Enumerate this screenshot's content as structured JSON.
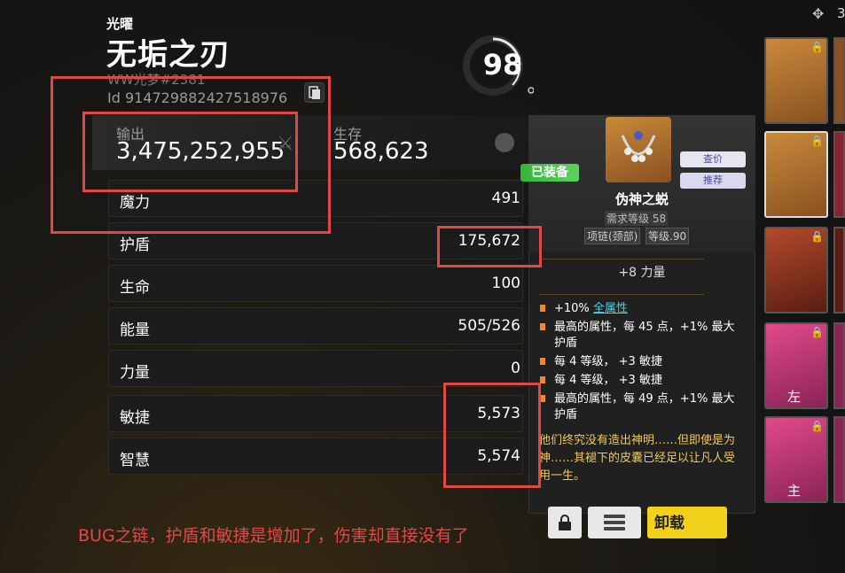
{
  "header": {
    "subtitle": "光曜",
    "title": "无垢之刃",
    "player_tag": "WW光梦#2381",
    "player_id": "Id 914729882427518976",
    "level": "98"
  },
  "top_right": {
    "count": "3"
  },
  "summary": {
    "output_label": "输出",
    "output_value": "3,475,252,955",
    "survival_label": "生存",
    "survival_value": "568,623"
  },
  "stats": [
    {
      "name": "魔力",
      "value": "491"
    },
    {
      "name": "护盾",
      "value": "175,672"
    },
    {
      "name": "生命",
      "value": "100"
    },
    {
      "name": "能量",
      "value": "505/526"
    },
    {
      "name": "力量",
      "value": "0"
    },
    {
      "name": "敏捷",
      "value": "5,573"
    },
    {
      "name": "智慧",
      "value": "5,574"
    }
  ],
  "item": {
    "equipped_badge": "已装备",
    "price_button": "查价",
    "recommend_button": "推荐",
    "name": "伪神之蜕",
    "required_level": "需求等级 58",
    "type": "项链(颈部)",
    "item_level": "等级.90",
    "main_stat": "+8 力量",
    "affixes": [
      {
        "prefix": "+10% ",
        "highlight": "全属性",
        "suffix": ""
      },
      {
        "prefix": "最高的属性，每 45 点，+1% 最大护盾",
        "highlight": "",
        "suffix": ""
      },
      {
        "prefix": "每 4 等级， +3 敏捷",
        "highlight": "",
        "suffix": ""
      },
      {
        "prefix": "每 4 等级， +3 敏捷",
        "highlight": "",
        "suffix": ""
      },
      {
        "prefix": "最高的属性，每 49 点，+1% 最大护盾",
        "highlight": "",
        "suffix": ""
      }
    ],
    "lore": "他们终究没有造出神明……但即使是为神……其褪下的皮囊已经足以让凡人受用一生。",
    "unload_button": "卸载"
  },
  "inventory": {
    "left_label": "左",
    "main_label": "主"
  },
  "annotation": "BUG之链，护盾和敏捷是增加了，伤害却直接没有了",
  "colors": {
    "annotation_red": "#e04848",
    "equipped_green": "#3fb845",
    "unload_yellow": "#f2d11c",
    "affix_orange": "#f0892a",
    "lore_gold": "#f0c95a",
    "highlight_cyan": "#3fd6e8"
  }
}
